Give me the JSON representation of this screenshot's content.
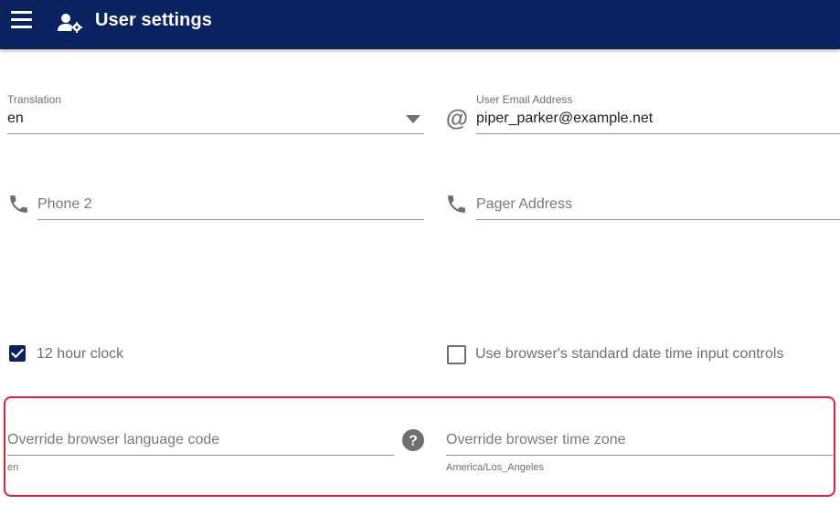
{
  "header": {
    "title": "User settings",
    "menu_icon": "hamburger-menu-icon",
    "user_icon": "user-cog-icon",
    "background_color": "#0b2260"
  },
  "translation": {
    "label": "Translation",
    "value": "en"
  },
  "email": {
    "label": "User Email Address",
    "value": "piper_parker@example.net",
    "icon": "at-icon"
  },
  "phone2": {
    "placeholder": "Phone 2",
    "icon": "phone-icon"
  },
  "pager": {
    "placeholder": "Pager Address",
    "icon": "phone-icon"
  },
  "twelve_hour_clock": {
    "label": "12 hour clock",
    "checked": true
  },
  "browser_datetime": {
    "label": "Use browser's standard date time input controls",
    "checked": false
  },
  "language_override": {
    "placeholder": "Override browser language code",
    "hint": "en",
    "help_icon": "help-circle-icon"
  },
  "timezone_override": {
    "placeholder": "Override browser time zone",
    "hint": "America/Los_Angeles"
  },
  "colors": {
    "accent": "#0b2260",
    "highlight_border": "#e0203c"
  }
}
